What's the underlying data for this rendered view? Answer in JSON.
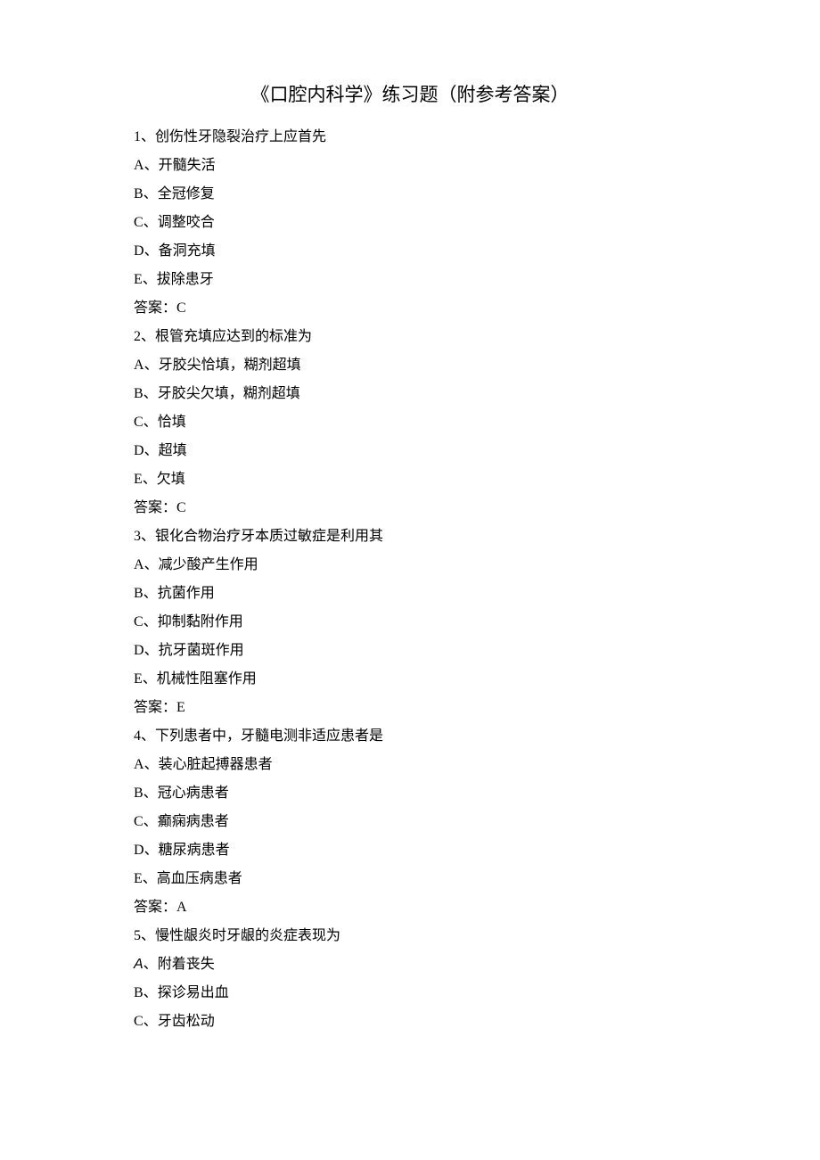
{
  "title": "《口腔内科学》练习题（附参考答案）",
  "questions": [
    {
      "num": "1",
      "stem": "创伤性牙隐裂治疗上应首先",
      "options": [
        {
          "label": "A",
          "text": "开髓失活"
        },
        {
          "label": "B",
          "text": "全冠修复"
        },
        {
          "label": "C",
          "text": "调整咬合"
        },
        {
          "label": "D",
          "text": "备洞充填"
        },
        {
          "label": "E",
          "text": "拔除患牙"
        }
      ],
      "answer_label": "答案：",
      "answer": "C"
    },
    {
      "num": "2",
      "stem": "根管充填应达到的标准为",
      "options": [
        {
          "label": "A",
          "text": "牙胶尖恰填，糊剂超填"
        },
        {
          "label": "B",
          "text": "牙胶尖欠填，糊剂超填"
        },
        {
          "label": "C",
          "text": "恰填"
        },
        {
          "label": "D",
          "text": "超填"
        },
        {
          "label": "E",
          "text": "欠填"
        }
      ],
      "answer_label": "答案：",
      "answer": "C"
    },
    {
      "num": "3",
      "stem": "银化合物治疗牙本质过敏症是利用其",
      "options": [
        {
          "label": "A",
          "text": "减少酸产生作用"
        },
        {
          "label": "B",
          "text": "抗菌作用"
        },
        {
          "label": "C",
          "text": "抑制黏附作用"
        },
        {
          "label": "D",
          "text": "抗牙菌斑作用"
        },
        {
          "label": "E",
          "text": "机械性阻塞作用"
        }
      ],
      "answer_label": "答案：",
      "answer": "E"
    },
    {
      "num": "4",
      "stem": "下列患者中，牙髓电测非适应患者是",
      "options": [
        {
          "label": "A",
          "text": "装心脏起搏器患者"
        },
        {
          "label": "B",
          "text": "冠心病患者"
        },
        {
          "label": "C",
          "text": "癫痫病患者"
        },
        {
          "label": "D",
          "text": "糖尿病患者"
        },
        {
          "label": "E",
          "text": "高血压病患者"
        }
      ],
      "answer_label": "答案：",
      "answer": "A"
    },
    {
      "num": "5",
      "stem": "慢性龈炎时牙龈的炎症表现为",
      "options": [
        {
          "label": "A",
          "text": "附着丧失",
          "italic": true
        },
        {
          "label": "B",
          "text": "探诊易出血"
        },
        {
          "label": "C",
          "text": "牙齿松动"
        }
      ],
      "answer_label": "",
      "answer": ""
    }
  ]
}
